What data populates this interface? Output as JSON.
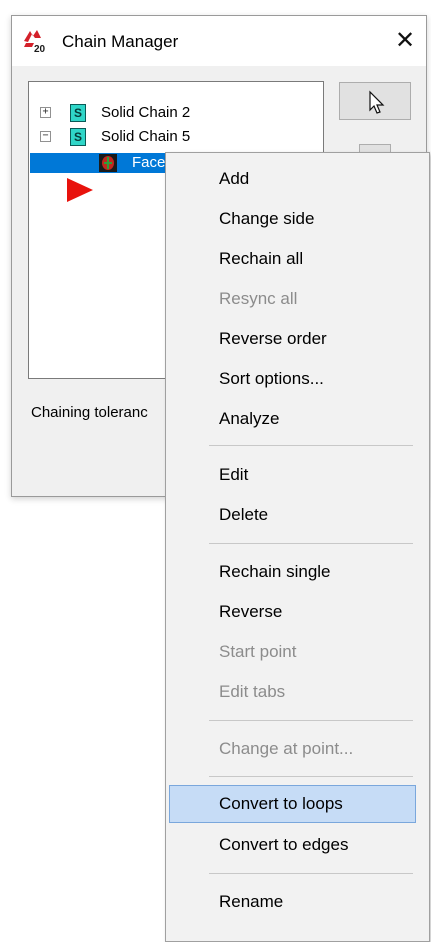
{
  "dialog": {
    "title": "Chain Manager",
    "close_glyph": "✕",
    "tolerance_label": "Chaining toleranc",
    "tree": [
      {
        "expander": "+",
        "label": "Solid Chain 2",
        "icon": "solid-chain-icon",
        "icon_letter": "S"
      },
      {
        "expander": "−",
        "label": "Solid Chain 5",
        "icon": "solid-chain-icon",
        "icon_letter": "S"
      }
    ],
    "selected_item": {
      "label": "Face",
      "icon": "face-icon"
    }
  },
  "context_menu": {
    "items": [
      {
        "label": "Add",
        "state": "enabled"
      },
      {
        "label": "Change side",
        "state": "enabled"
      },
      {
        "label": "Rechain all",
        "state": "enabled"
      },
      {
        "label": "Resync all",
        "state": "disabled"
      },
      {
        "label": "Reverse order",
        "state": "enabled"
      },
      {
        "label": "Sort options...",
        "state": "enabled"
      },
      {
        "label": "Analyze",
        "state": "enabled"
      },
      {
        "label": "Edit",
        "state": "enabled"
      },
      {
        "label": "Delete",
        "state": "enabled"
      },
      {
        "label": "Rechain single",
        "state": "enabled"
      },
      {
        "label": "Reverse",
        "state": "enabled"
      },
      {
        "label": "Start point",
        "state": "disabled"
      },
      {
        "label": "Edit tabs",
        "state": "disabled"
      },
      {
        "label": "Change at point...",
        "state": "disabled"
      },
      {
        "label": "Convert to loops",
        "state": "highlighted"
      },
      {
        "label": "Convert to edges",
        "state": "enabled"
      },
      {
        "label": "Rename",
        "state": "enabled"
      }
    ]
  },
  "colors": {
    "selection": "#0078d7",
    "menu_highlight": "#c6dcf6",
    "disabled_text": "#8c8c8c",
    "pointer_red": "#e8120c",
    "solid_icon": "#2fd6c8"
  }
}
